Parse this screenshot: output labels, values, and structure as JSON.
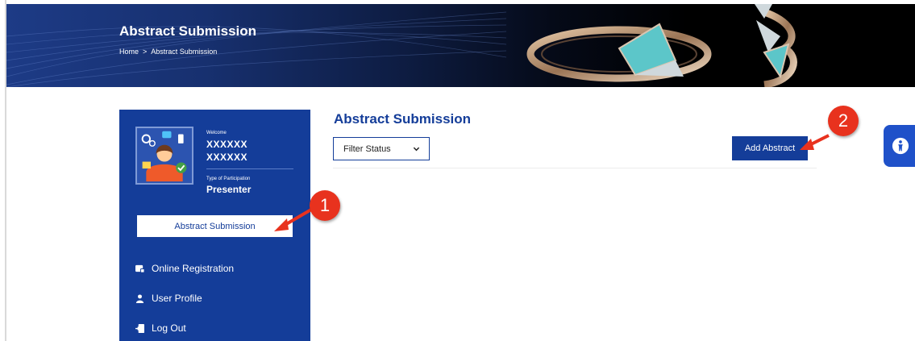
{
  "banner": {
    "title": "Abstract Submission",
    "breadcrumb": {
      "home": "Home",
      "separator": ">",
      "current": "Abstract Submission"
    }
  },
  "sidebar": {
    "welcome_label": "Welcome",
    "user_name_line1": "XXXXXX",
    "user_name_line2": "XXXXXX",
    "participation_label": "Type of Participation",
    "participation_value": "Presenter",
    "active_button": "Abstract Submission",
    "items": [
      {
        "label": "Online Registration",
        "icon": "registration-icon"
      },
      {
        "label": "User Profile",
        "icon": "user-icon"
      },
      {
        "label": "Log Out",
        "icon": "logout-icon"
      }
    ]
  },
  "main": {
    "title": "Abstract Submission",
    "filter": {
      "selected": "Filter Status"
    },
    "add_button": "Add Abstract"
  },
  "annotations": {
    "callout_1": "1",
    "callout_2": "2"
  },
  "colors": {
    "primary": "#143d99",
    "callout": "#e8321e",
    "accessibility": "#1f51c9"
  }
}
